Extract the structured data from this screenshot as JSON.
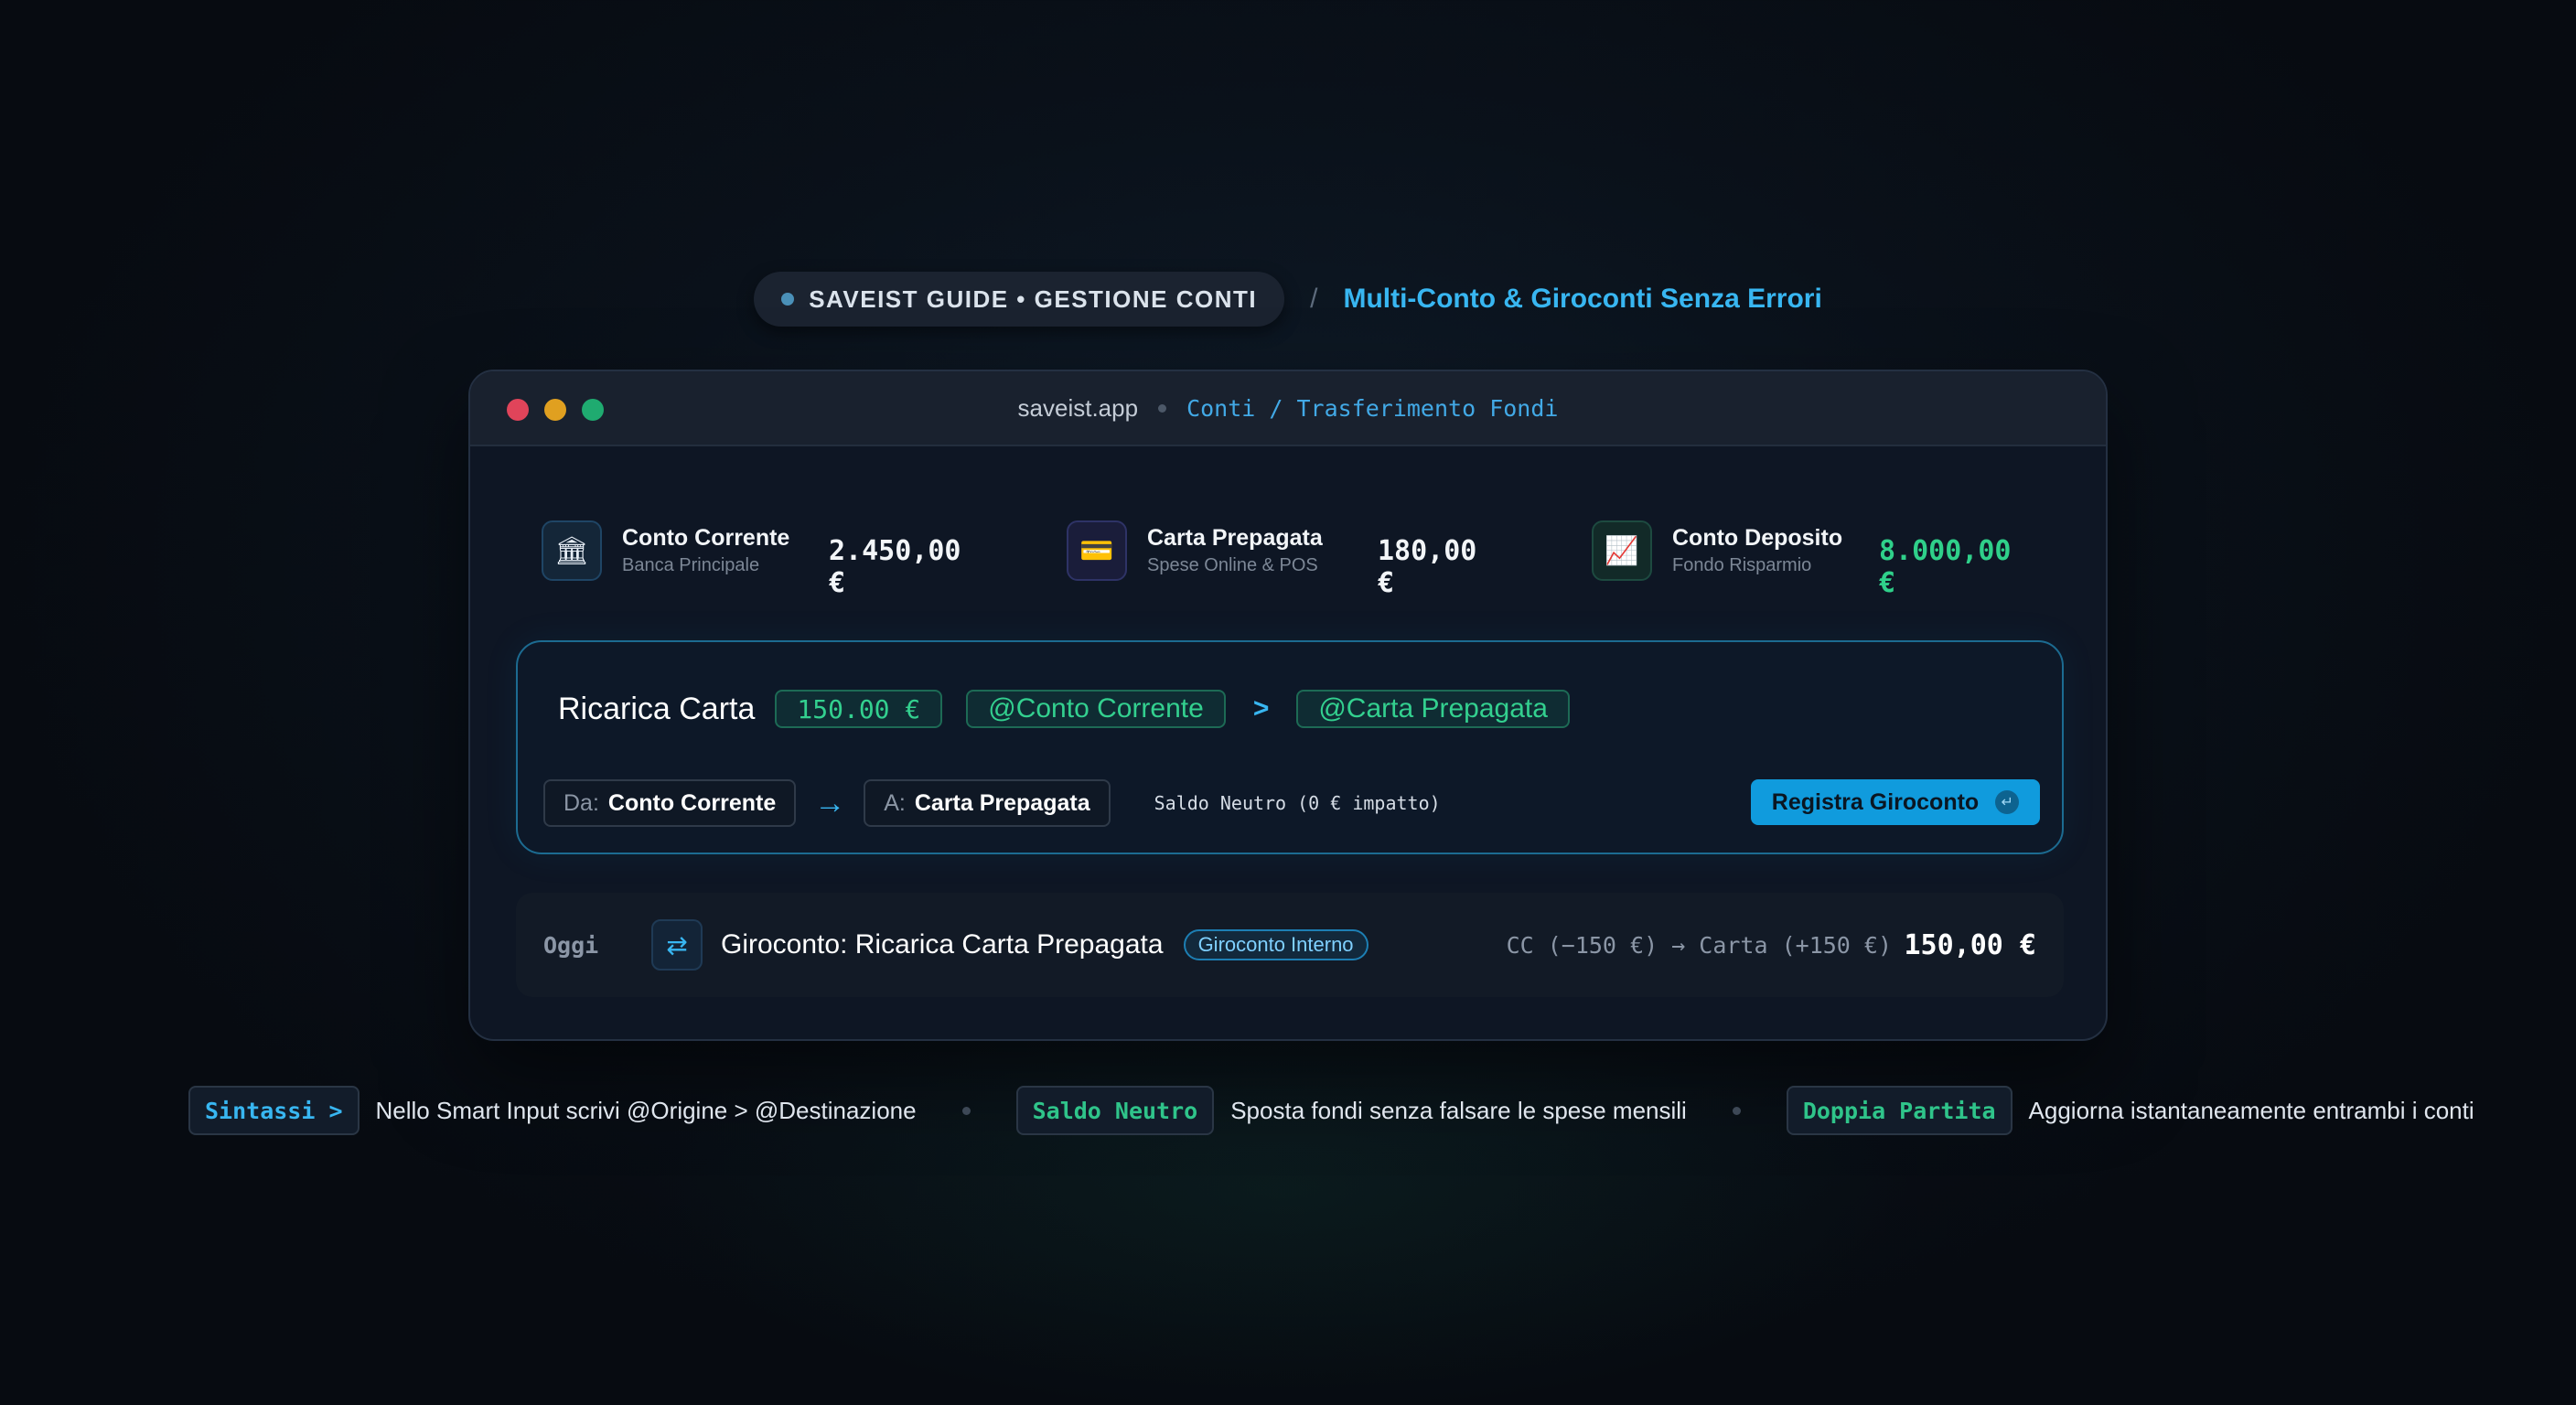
{
  "header": {
    "badge_text": "SAVEIST GUIDE • GESTIONE CONTI",
    "separator": "/",
    "title": "Multi-Conto & Giroconti Senza Errori"
  },
  "window": {
    "url": "saveist.app",
    "path": "Conti / Trasferimento Fondi",
    "lights": [
      "#e0445a",
      "#e0a020",
      "#1fab70"
    ]
  },
  "accounts": [
    {
      "name": "Conto Corrente",
      "subtitle": "Banca Principale",
      "balance": "2.450,00 €",
      "icon": "bank-icon",
      "glyph": "🏛",
      "balance_color": "#f2f5f8"
    },
    {
      "name": "Carta Prepagata",
      "subtitle": "Spese Online & POS",
      "balance": "180,00 €",
      "icon": "credit-card-icon",
      "glyph": "💳",
      "balance_color": "#f2f5f8"
    },
    {
      "name": "Conto Deposito",
      "subtitle": "Fondo Risparmio",
      "balance": "8.000,00 €",
      "icon": "chart-up-icon",
      "glyph": "📈",
      "balance_color": "#2fd08a"
    }
  ],
  "smart_input": {
    "label": "Ricarica Carta",
    "amount": "150.00 €",
    "from_tag": "@Conto Corrente",
    "operator": ">",
    "to_tag": "@Carta Prepagata",
    "from_key": "Da:",
    "from_value": "Conto Corrente",
    "to_key": "A:",
    "to_value": "Carta Prepagata",
    "neutral_note": "Saldo Neutro (0 € impatto)",
    "submit_label": "Registra Giroconto",
    "enter_glyph": "↵"
  },
  "transaction": {
    "day": "Oggi",
    "title": "Giroconto: Ricarica Carta Prepagata",
    "badge": "Giroconto Interno",
    "detail": "CC (−150 €) → Carta (+150 €)",
    "amount": "150,00 €"
  },
  "tips": [
    {
      "key": "Sintassi >",
      "text": "Nello Smart Input scrivi @Origine > @Destinazione",
      "color": "#38b6f1"
    },
    {
      "key": "Saldo Neutro",
      "text": "Sposta fondi senza falsare le spese mensili",
      "color": "#2fc48a"
    },
    {
      "key": "Doppia Partita",
      "text": "Aggiorna istantaneamente entrambi i conti",
      "color": "#2fc48a"
    }
  ]
}
